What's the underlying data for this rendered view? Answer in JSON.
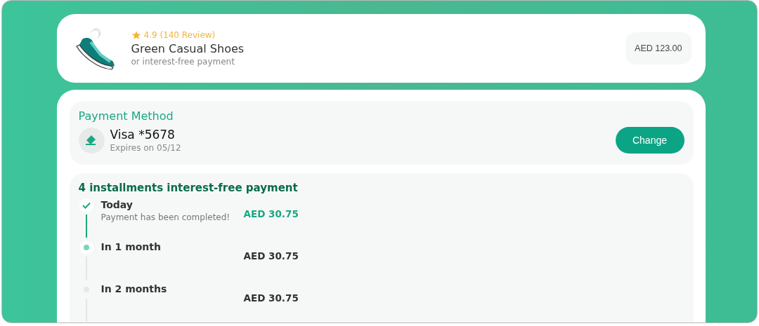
{
  "product": {
    "rating": "4.9 (140 Review)",
    "name": "Green Casual Shoes",
    "subtitle": "or interest-free payment",
    "price": "AED 123.00"
  },
  "payment_method": {
    "heading": "Payment Method",
    "card": "Visa *5678",
    "expiry": "Expires on 05/12",
    "button": "Change"
  },
  "installments": {
    "heading": "4 installments interest-free payment",
    "items": [
      {
        "kind": "completed",
        "label": "Today",
        "note": "Payment has been completed!",
        "amount": "AED 30.75"
      },
      {
        "kind": "current",
        "label": "In 1 month",
        "amount": "AED 30.75"
      },
      {
        "kind": "upcoming",
        "label": "In 2 months",
        "amount": "AED 30.75"
      }
    ]
  }
}
